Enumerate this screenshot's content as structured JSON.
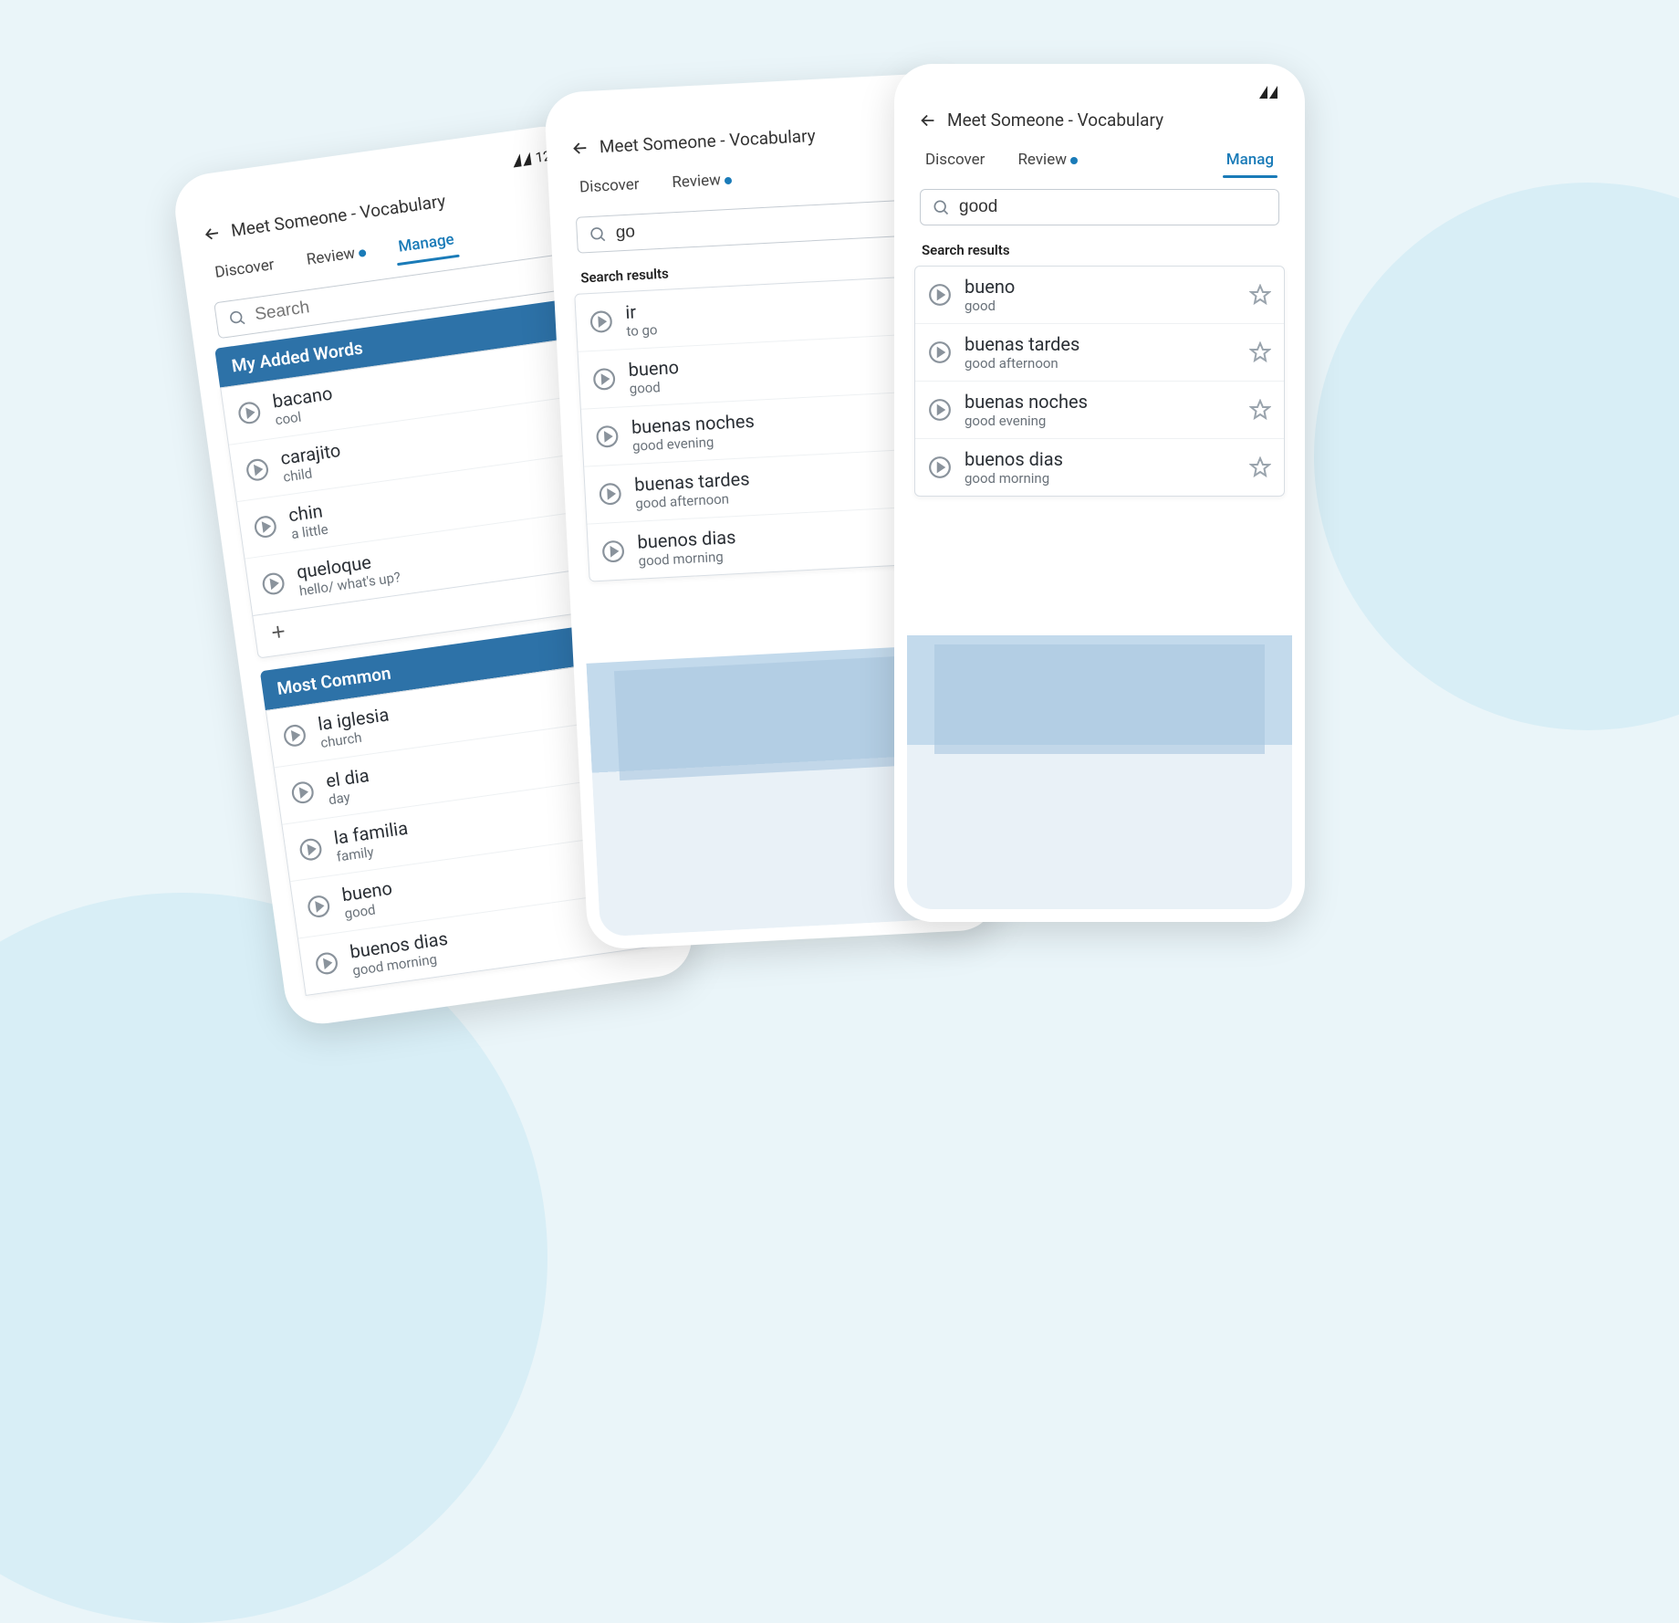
{
  "shared": {
    "header_title": "Meet Someone - Vocabulary",
    "tabs": {
      "discover": "Discover",
      "review": "Review",
      "manage": "Manage",
      "manage_cut": "Manag"
    },
    "search_placeholder": "Search",
    "search_results_label": "Search results",
    "status_time": "12:"
  },
  "phone1": {
    "sections": {
      "added": {
        "title": "My Added Words",
        "words": [
          {
            "w": "bacano",
            "t": "cool"
          },
          {
            "w": "carajito",
            "t": "child"
          },
          {
            "w": "chin",
            "t": "a little"
          },
          {
            "w": "queloque",
            "t": "hello/ what's up?"
          }
        ]
      },
      "common": {
        "title": "Most Common",
        "words": [
          {
            "w": "la iglesia",
            "t": "church"
          },
          {
            "w": "el dia",
            "t": "day"
          },
          {
            "w": "la familia",
            "t": "family"
          },
          {
            "w": "bueno",
            "t": "good"
          },
          {
            "w": "buenos dias",
            "t": "good morning"
          }
        ]
      }
    }
  },
  "phone2": {
    "search_value": "go",
    "results": [
      {
        "w": "ir",
        "t": "to go"
      },
      {
        "w": "bueno",
        "t": "good"
      },
      {
        "w": "buenas noches",
        "t": "good evening"
      },
      {
        "w": "buenas tardes",
        "t": "good afternoon"
      },
      {
        "w": "buenos dias",
        "t": "good morning"
      }
    ]
  },
  "phone3": {
    "search_value": "good",
    "results": [
      {
        "w": "bueno",
        "t": "good"
      },
      {
        "w": "buenas tardes",
        "t": "good afternoon"
      },
      {
        "w": "buenas noches",
        "t": "good evening"
      },
      {
        "w": "buenos dias",
        "t": "good morning"
      }
    ]
  }
}
